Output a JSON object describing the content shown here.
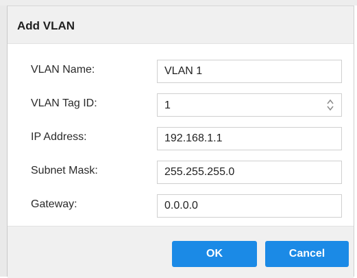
{
  "dialog": {
    "title": "Add VLAN",
    "fields": [
      {
        "label": "VLAN Name:",
        "value": "VLAN 1"
      },
      {
        "label": "VLAN Tag ID:",
        "value": "1"
      },
      {
        "label": "IP Address:",
        "value": "192.168.1.1"
      },
      {
        "label": "Subnet Mask:",
        "value": "255.255.255.0"
      },
      {
        "label": "Gateway:",
        "value": "0.0.0.0"
      }
    ],
    "ok_label": "OK",
    "cancel_label": "Cancel"
  },
  "icons": {
    "stepper": "up-down-stepper-icon"
  },
  "colors": {
    "button": "#1b8ae6",
    "titlebar": "#f0f0f0"
  }
}
